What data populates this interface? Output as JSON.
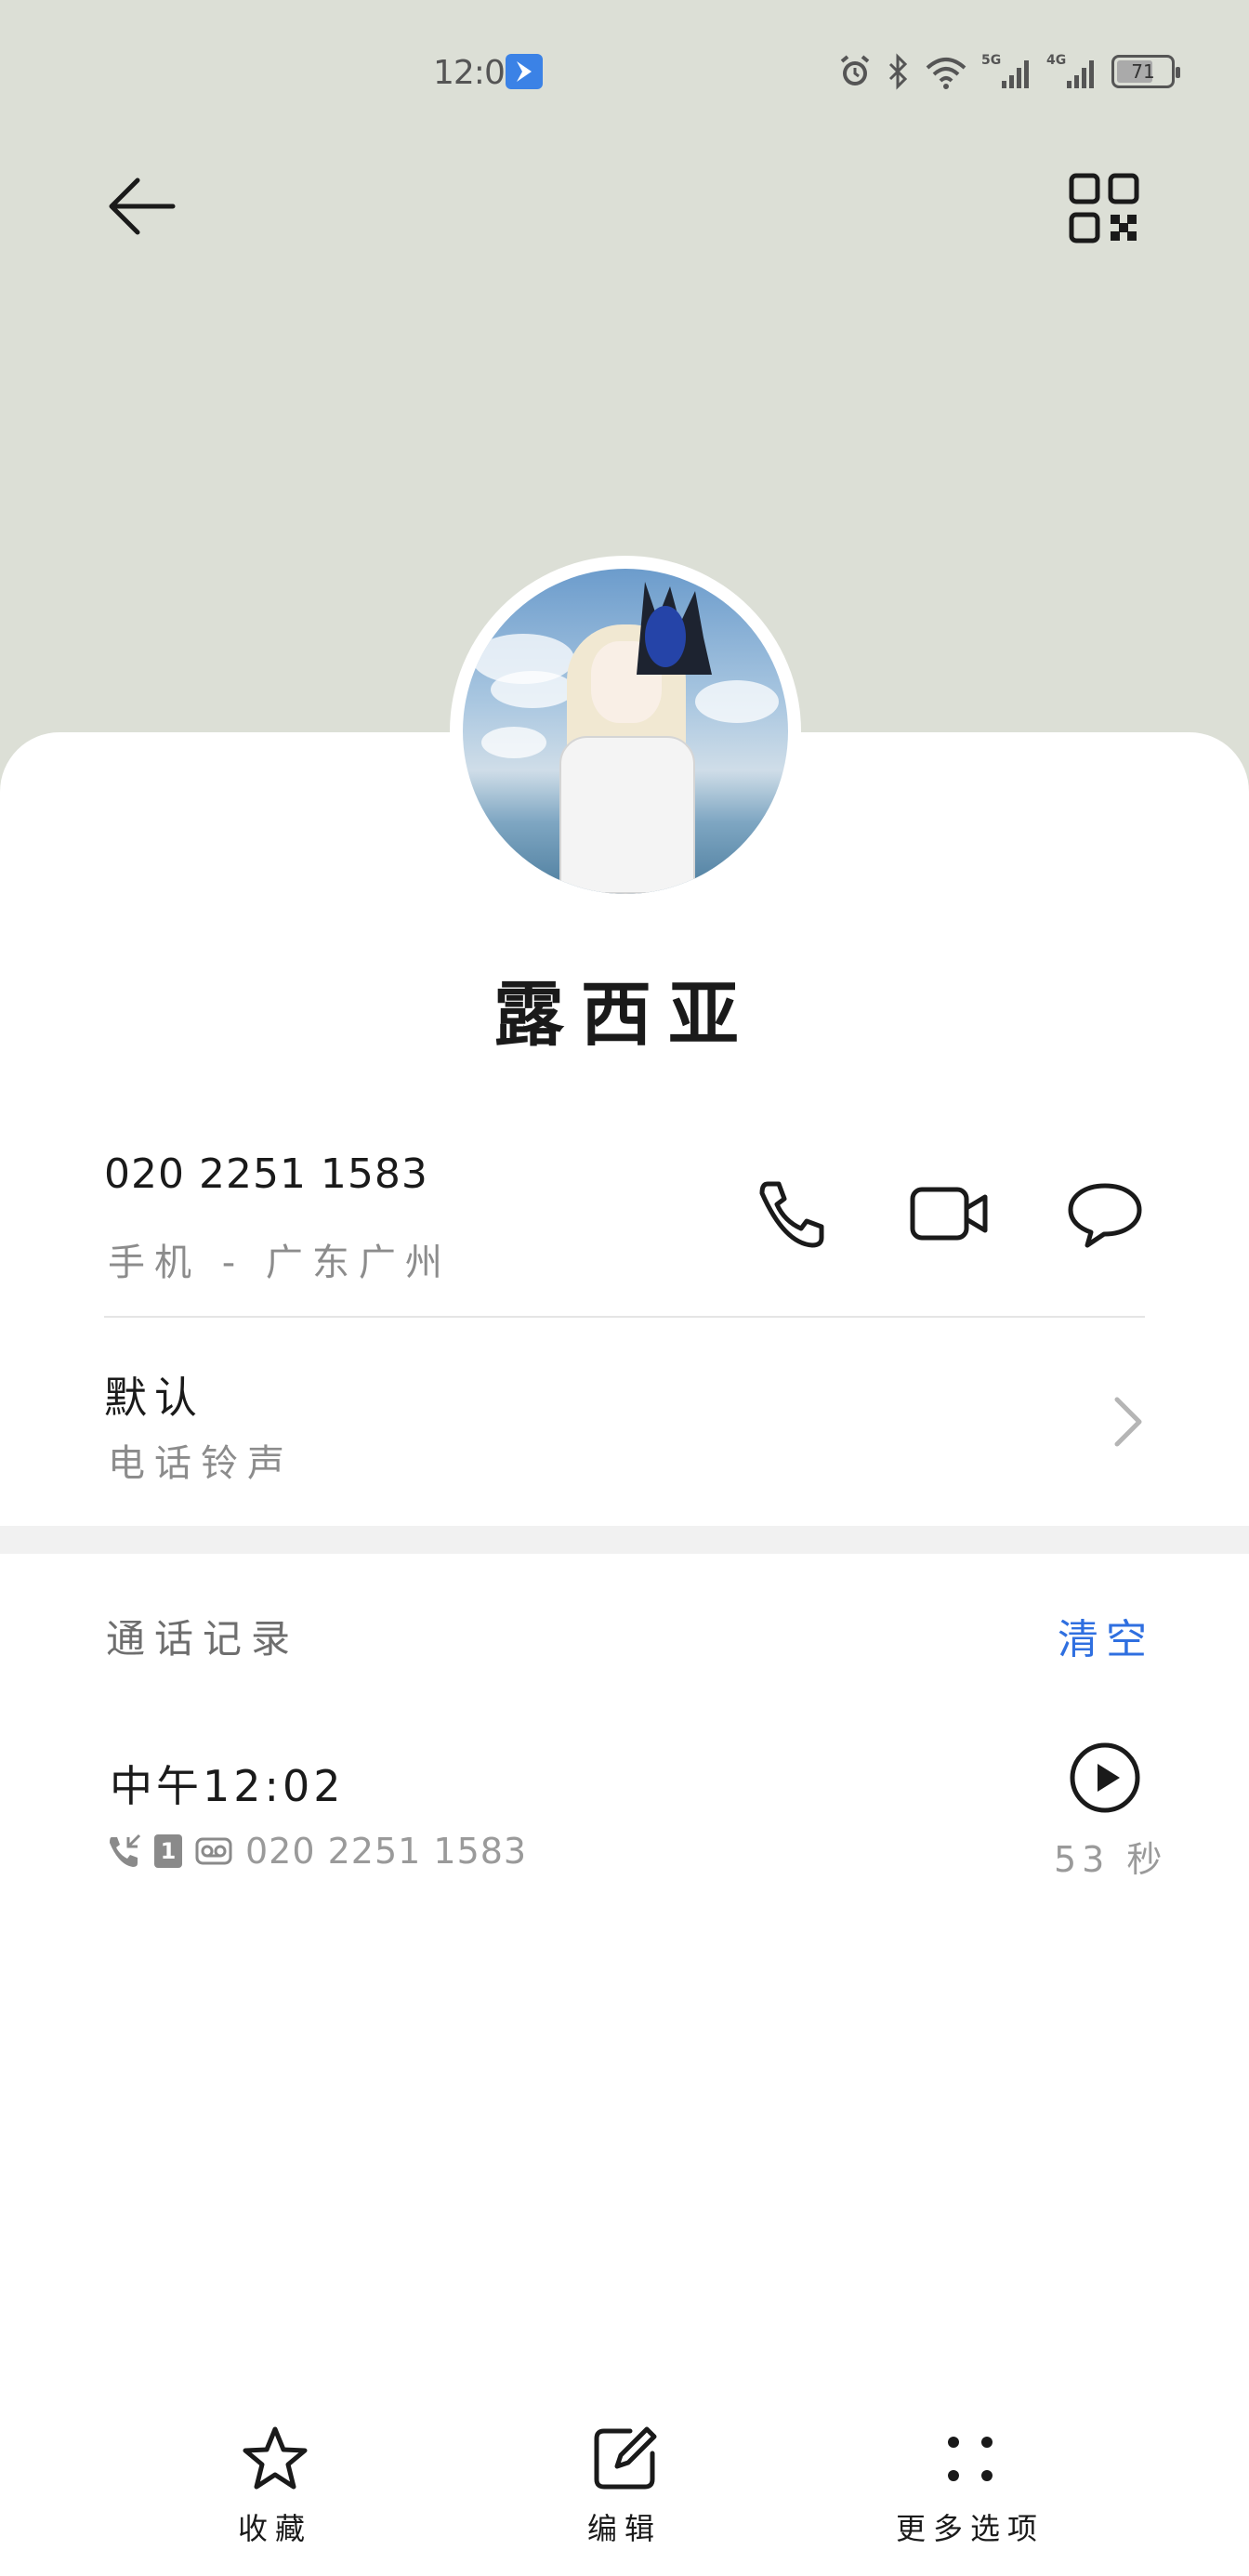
{
  "status_bar": {
    "time": "12:06",
    "network_1": "5G",
    "network_2": "4G",
    "battery": "71",
    "battery_fraction": 0.71
  },
  "contact": {
    "name": "露西亚",
    "phone_number": "020 2251 1583",
    "phone_meta": "手机 - 广东广州"
  },
  "ringtone": {
    "value": "默认",
    "label": "电话铃声"
  },
  "call_log": {
    "title": "通话记录",
    "clear_label": "清空",
    "entries": [
      {
        "time": "中午12:02",
        "sim": "1",
        "number": "020 2251 1583",
        "duration": "53 秒"
      }
    ]
  },
  "toolbar": {
    "favorite_label": "收藏",
    "edit_label": "编辑",
    "more_label": "更多选项"
  },
  "colors": {
    "header_bg": "#dcdfd6",
    "accent": "#2f6fe0"
  }
}
